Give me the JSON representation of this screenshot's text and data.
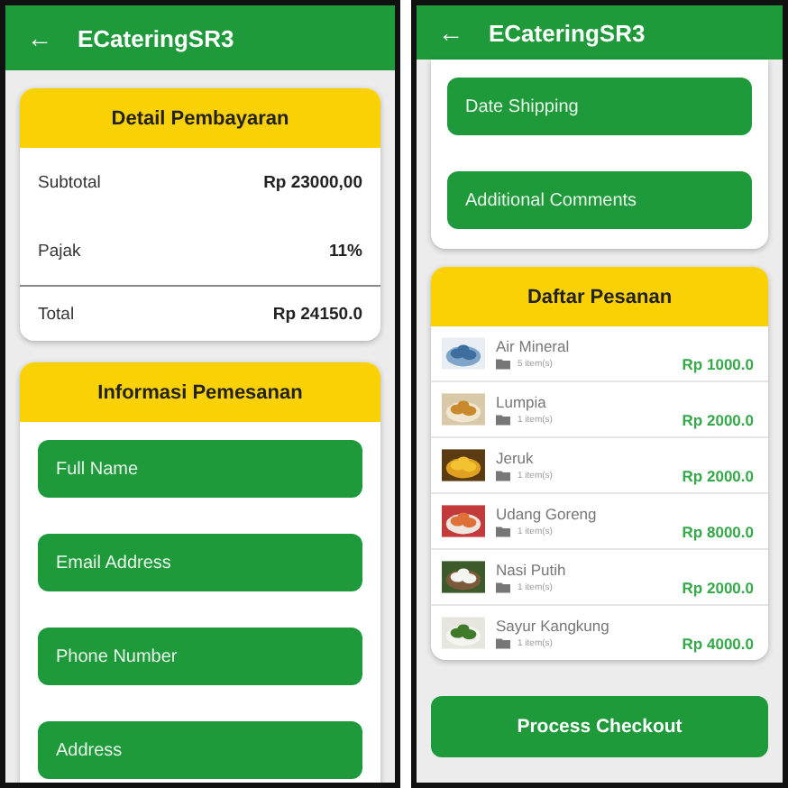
{
  "left_screen": {
    "app_bar": {
      "back": "←",
      "title": "ECateringSR3"
    },
    "payment_card": {
      "title": "Detail Pembayaran",
      "rows": [
        {
          "label": "Subtotal",
          "value": "Rp 23000,00"
        },
        {
          "label": "Pajak",
          "value": "11%"
        }
      ],
      "total": {
        "label": "Total",
        "value": "Rp 24150.0"
      }
    },
    "order_info_card": {
      "title": "Informasi Pemesanan",
      "fields": [
        {
          "placeholder": "Full Name"
        },
        {
          "placeholder": "Email Address"
        },
        {
          "placeholder": "Phone Number"
        },
        {
          "placeholder": "Address"
        }
      ]
    }
  },
  "right_screen": {
    "app_bar": {
      "back": "←",
      "title": "ECateringSR3"
    },
    "fields": [
      {
        "placeholder": "Date Shipping"
      },
      {
        "placeholder": "Additional Comments"
      }
    ],
    "order_list": {
      "title": "Daftar Pesanan",
      "items": [
        {
          "name": "Air Mineral",
          "count": "5 item(s)",
          "price": "Rp 1000.0"
        },
        {
          "name": "Lumpia",
          "count": "1 item(s)",
          "price": "Rp 2000.0"
        },
        {
          "name": "Jeruk",
          "count": "1 item(s)",
          "price": "Rp 2000.0"
        },
        {
          "name": "Udang Goreng",
          "count": "1 item(s)",
          "price": "Rp 8000.0"
        },
        {
          "name": "Nasi Putih",
          "count": "1 item(s)",
          "price": "Rp 2000.0"
        },
        {
          "name": "Sayur Kangkung",
          "count": "1 item(s)",
          "price": "Rp 4000.0"
        }
      ]
    },
    "checkout_button": "Process Checkout"
  }
}
